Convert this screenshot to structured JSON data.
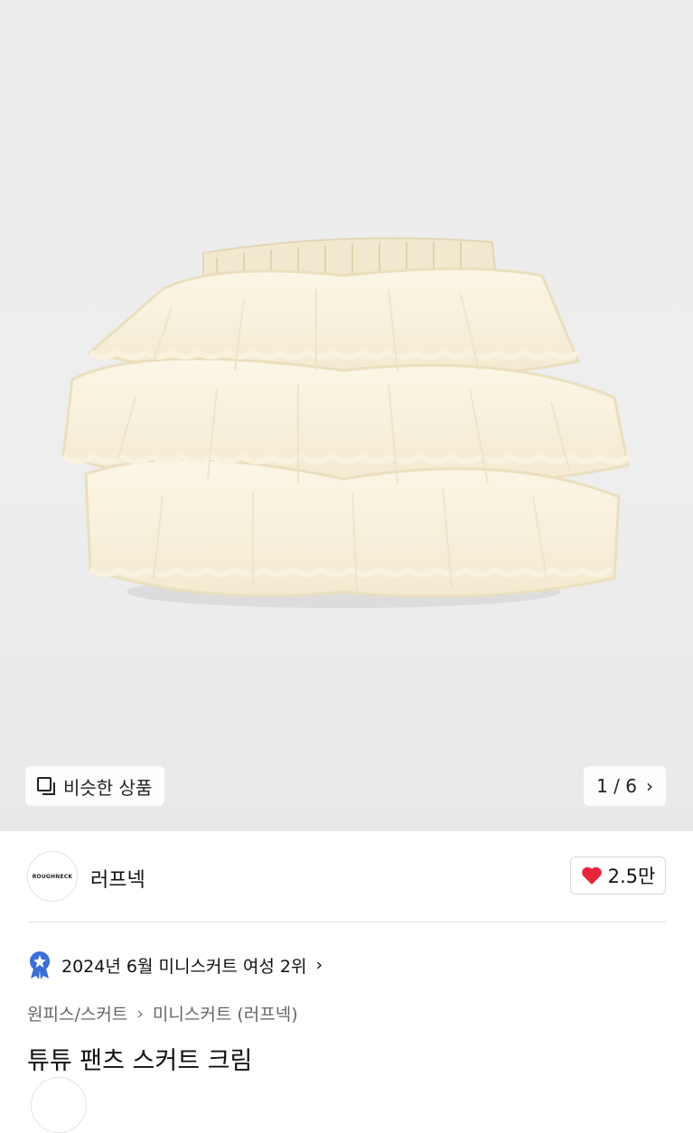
{
  "gallery": {
    "similar_label": "비슷한 상품",
    "pager": "1 / 6",
    "image_icon": "ruffle-skirt-product-photo"
  },
  "seller": {
    "logo_text": "ROUGHNECK",
    "name": "러프넥",
    "likes": "2.5만",
    "heart_color": "#e8243a"
  },
  "ranking": {
    "text": "2024년 6월 미니스커트 여성 2위",
    "badge_color": "#3a6fd8"
  },
  "breadcrumb": {
    "category": "원피스/스커트",
    "subcategory": "미니스커트 (러프넥)"
  },
  "product": {
    "title": "튜튜 팬츠 스커트 크림"
  }
}
